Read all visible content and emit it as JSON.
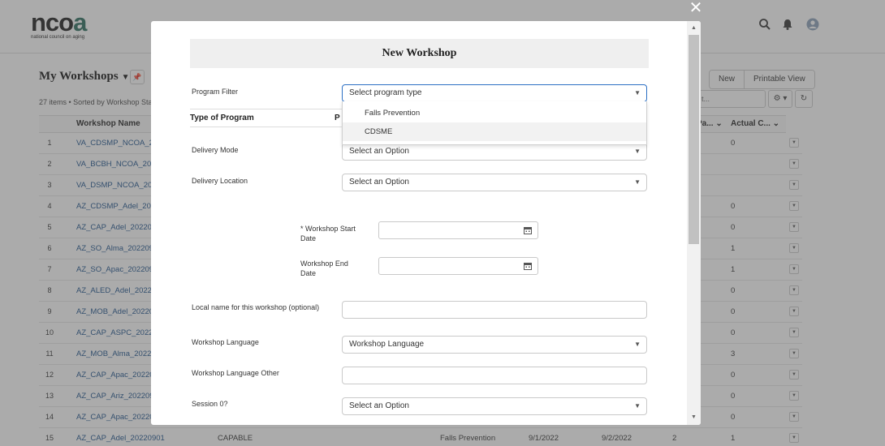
{
  "brand": {
    "logo_text": "ncoa",
    "logo_sub": "national council on aging"
  },
  "list": {
    "title": "My Workshops",
    "meta": "27 items • Sorted by Workshop Sta",
    "new_label": "New",
    "printable_label": "Printable View",
    "search_stub": "t...",
    "columns": {
      "name": "Workshop Name",
      "col_pa": "Pa...",
      "col_actual": "Actual C..."
    },
    "rows": [
      {
        "num": "1",
        "name": "VA_CDSMP_NCOA_20",
        "actual": "0"
      },
      {
        "num": "2",
        "name": "VA_BCBH_NCOA_202",
        "actual": ""
      },
      {
        "num": "3",
        "name": "VA_DSMP_NCOA_202",
        "actual": ""
      },
      {
        "num": "4",
        "name": "AZ_CDSMP_Adel_202",
        "actual": "0"
      },
      {
        "num": "5",
        "name": "AZ_CAP_Adel_202209",
        "actual": "0"
      },
      {
        "num": "6",
        "name": "AZ_SO_Alma_2022090",
        "actual": "1"
      },
      {
        "num": "7",
        "name": "AZ_SO_Apac_2022090",
        "actual": "1"
      },
      {
        "num": "8",
        "name": "AZ_ALED_Adel_20220",
        "actual": "0"
      },
      {
        "num": "9",
        "name": "AZ_MOB_Adel_20220",
        "actual": "0"
      },
      {
        "num": "10",
        "name": "AZ_CAP_ASPC_20220",
        "actual": "0"
      },
      {
        "num": "11",
        "name": "AZ_MOB_Alma_20220",
        "actual": "3"
      },
      {
        "num": "12",
        "name": "AZ_CAP_Apac_20220",
        "actual": "0"
      },
      {
        "num": "13",
        "name": "AZ_CAP_Ariz_202209",
        "actual": "0"
      },
      {
        "num": "14",
        "name": "AZ_CAP_Apac_20220",
        "actual": "0"
      }
    ],
    "last_row": {
      "num": "15",
      "name": "AZ_CAP_Adel_20220901",
      "type": "CAPABLE",
      "program": "Falls Prevention",
      "start": "9/1/2022",
      "end": "9/2/2022",
      "pa": "2",
      "actual": "1"
    }
  },
  "modal": {
    "title": "New Workshop",
    "program_filter_label": "Program Filter",
    "program_type_value": "Select program type",
    "dropdown_options": [
      "Falls Prevention",
      "CDSME"
    ],
    "type_of_program_label": "Type of Program",
    "type_of_program_p": "P",
    "delivery_mode_label": "Delivery Mode",
    "delivery_mode_value": "Select an Option",
    "delivery_location_label": "Delivery Location",
    "delivery_location_value": "Select an Option",
    "start_date_label": "* Workshop Start Date",
    "end_date_label": "Workshop End Date",
    "local_name_label": "Local name for this workshop (optional)",
    "language_label": "Workshop Language",
    "language_value": "Workshop Language",
    "language_other_label": "Workshop Language Other",
    "session0_label": "Session 0?",
    "session0_value": "Select an Option"
  }
}
